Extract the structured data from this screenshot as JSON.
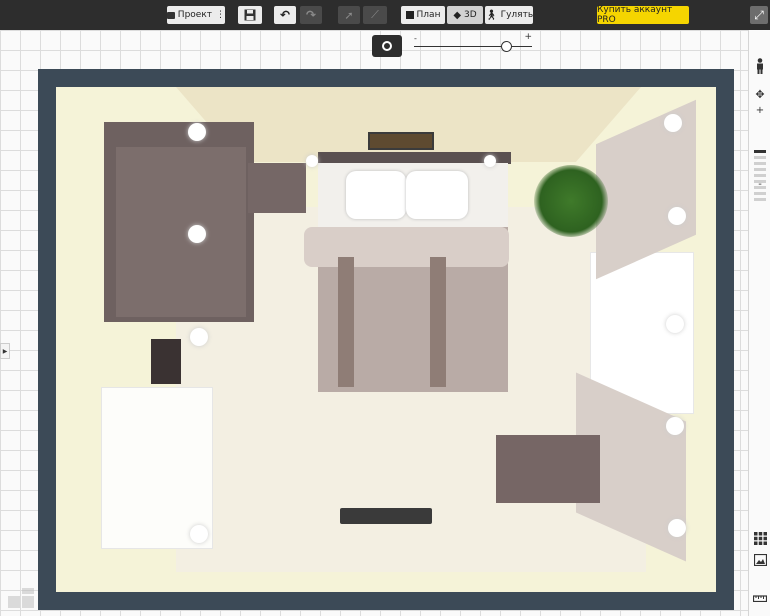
{
  "toolbar": {
    "project_label": "Проект",
    "plan_label": "План",
    "view3d_label": "3D",
    "walk_label": "Гулять",
    "buy_pro_label": "Купить аккаунт PRO"
  },
  "zoom": {
    "minus": "-",
    "plus": "+",
    "level": 0.8
  },
  "right_panel": {
    "zoom_plus": "+",
    "zoom_minus": "-"
  },
  "icons": {
    "project": "folder-icon",
    "project_more": "more-vertical-icon",
    "save": "floppy-disk-icon",
    "undo": "undo-icon",
    "redo": "redo-icon",
    "select": "cursor-arrow-icon",
    "measure": "ruler-line-icon",
    "plan": "square-icon",
    "view3d": "cube-icon",
    "walk": "walking-person-icon",
    "fullscreen": "fullscreen-icon",
    "camera": "camera-icon",
    "person": "person-icon",
    "compass": "compass-icon",
    "grid": "grid-icon",
    "image": "image-icon",
    "ruler": "ruler-icon",
    "sidebar_toggle": "chevron-right-icon"
  },
  "colors": {
    "toolbar_bg": "#2d2d2d",
    "pro_button": "#f5d500",
    "wall": "#3c4a57",
    "floor": "#f5f3d8",
    "furniture": "#756766"
  }
}
